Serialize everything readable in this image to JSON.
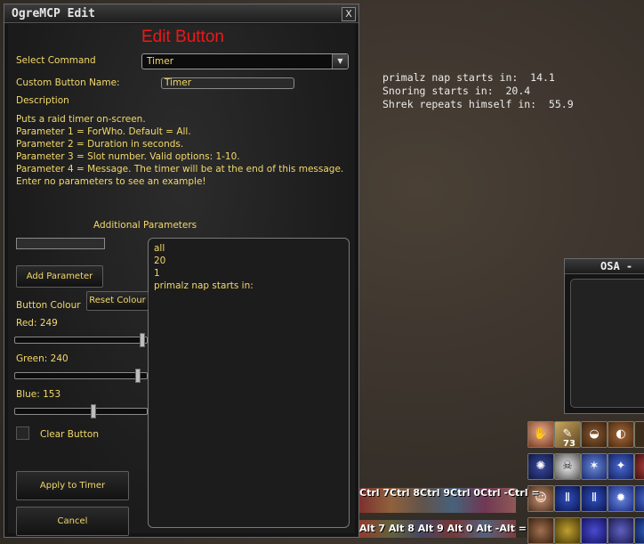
{
  "window": {
    "title": "OgreMCP Edit",
    "close_label": "X"
  },
  "heading": "Edit Button",
  "select_command": {
    "label": "Select Command",
    "value": "Timer"
  },
  "custom_name": {
    "label": "Custom Button Name:",
    "value": "Timer"
  },
  "description": {
    "label": "Description",
    "lines": [
      "Puts a raid timer on-screen.",
      "Parameter 1 = ForWho. Default = All.",
      "Parameter 2 = Duration in seconds.",
      "Parameter 3 = Slot number. Valid options: 1-10.",
      "Parameter 4 = Message. The timer will be at the end of this message.",
      "Enter no parameters to see an example!"
    ]
  },
  "additional_params": {
    "label": "Additional Parameters",
    "input_value": "",
    "add_button": "Add Parameter",
    "values": [
      "all",
      "20",
      "1",
      "primalz nap starts in:"
    ]
  },
  "colour": {
    "label": "Button Colour",
    "reset_button": "Reset Colour",
    "red_label": "Red: 249",
    "red": 249,
    "green_label": "Green: 240",
    "green": 240,
    "blue_label": "Blue: 153",
    "blue": 153,
    "max": 255
  },
  "clear_button": {
    "label": "Clear Button",
    "checked": false
  },
  "apply_button": "Apply to Timer",
  "cancel_button": "Cancel",
  "timers": [
    "primalz nap starts in:  14.1",
    "Snoring starts in:  20.4",
    "Shrek repeats himself in:  55.9"
  ],
  "osa_window": {
    "title": "OSA -"
  },
  "hotbar": {
    "stack_count": "73",
    "row1_keys": "Ctrl 7Ctrl 8Ctrl 9Ctrl 0Ctrl -Ctrl =",
    "row2_keys": "Alt 7 Alt 8 Alt 9 Alt 0  Alt -Alt ="
  }
}
